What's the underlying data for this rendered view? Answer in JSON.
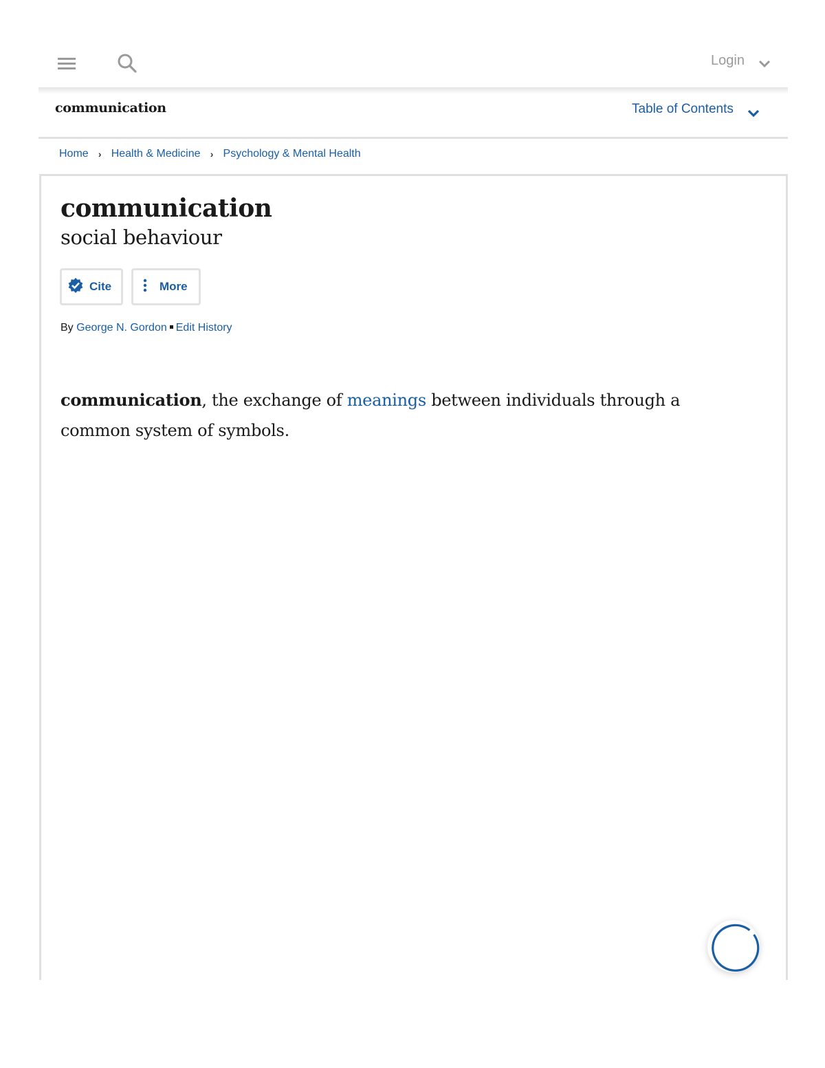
{
  "header": {
    "menu_icon": "hamburger-menu-icon",
    "search_icon": "search-icon",
    "login_label": "Login",
    "login_icon": "chevron-down-icon"
  },
  "subbar": {
    "article_title": "communication",
    "toc_label": "Table of Contents",
    "toc_icon": "chevron-down-icon"
  },
  "breadcrumb": {
    "items": [
      {
        "label": "Home"
      },
      {
        "label": "Health & Medicine"
      },
      {
        "label": "Psychology & Mental Health"
      }
    ],
    "separator_icon": "chevron-right-icon"
  },
  "article": {
    "title": "communication",
    "subtitle": "social behaviour",
    "buttons": {
      "cite_label": "Cite",
      "cite_icon": "verified-badge-icon",
      "more_label": "More",
      "more_icon": "vertical-dots-icon"
    },
    "byline": {
      "prefix": "By",
      "author": "George N. Gordon",
      "edit_history": "Edit History"
    },
    "intro": {
      "term": "communication",
      "text_before_link": ", the exchange of ",
      "link": "meanings",
      "text_after_link": " between individuals through a common system of symbols."
    }
  },
  "loading_indicator": {
    "icon": "loading-spinner-icon"
  },
  "colors": {
    "link_blue": "#1a5ea6",
    "icon_gray": "#9a9a9a",
    "border_gray": "#e0e0e0",
    "text": "#1a1a1a"
  }
}
